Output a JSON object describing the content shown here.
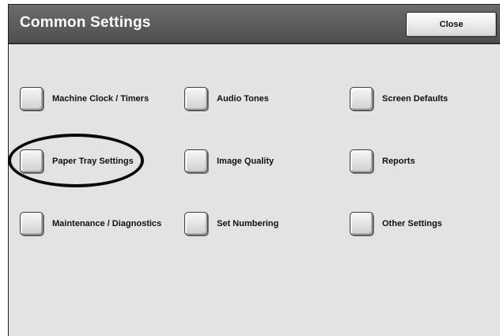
{
  "header": {
    "title": "Common Settings",
    "close_label": "Close"
  },
  "options": [
    {
      "label": "Machine Clock / Timers"
    },
    {
      "label": "Audio Tones"
    },
    {
      "label": "Screen Defaults"
    },
    {
      "label": "Paper Tray Settings"
    },
    {
      "label": "Image Quality"
    },
    {
      "label": "Reports"
    },
    {
      "label": "Maintenance / Diagnostics"
    },
    {
      "label": "Set Numbering"
    },
    {
      "label": "Other Settings"
    }
  ],
  "annotation": {
    "highlighted_option": "Paper Tray Settings"
  },
  "colors": {
    "title_bar": "#5e5e5e",
    "panel_background": "#e3e3e3",
    "button_face": "#e6e6e6"
  }
}
